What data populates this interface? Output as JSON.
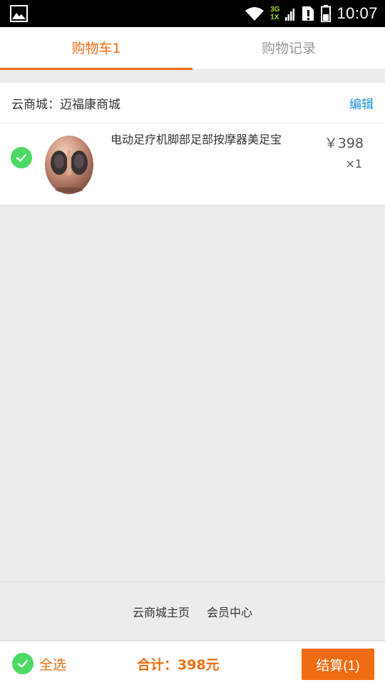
{
  "status_bar": {
    "time": "10:07",
    "network_top": "3G",
    "network_bottom": "1X"
  },
  "tabs": [
    {
      "label": "购物车1",
      "active": true
    },
    {
      "label": "购物记录",
      "active": false
    }
  ],
  "shop": {
    "name": "云商城：迈福康商城",
    "edit_label": "编辑",
    "items": [
      {
        "name": "电动足疗机脚部足部按摩器美足宝",
        "price": "￥398",
        "quantity": "×1",
        "checked": true
      }
    ]
  },
  "footer_links": [
    "云商城主页",
    "会员中心"
  ],
  "bottom_bar": {
    "select_all_label": "全选",
    "total_label": "合计：398元",
    "checkout_label": "结算(1)"
  },
  "colors": {
    "accent": "#f06c12",
    "check": "#4cd964",
    "link": "#1a8fd8"
  }
}
